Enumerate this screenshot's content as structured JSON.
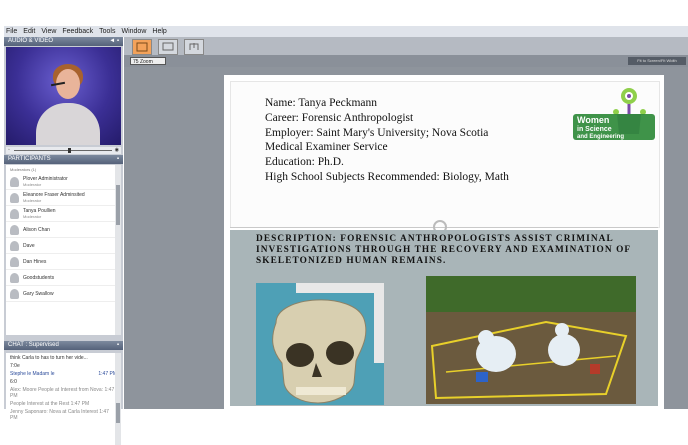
{
  "menu": [
    "File",
    "Edit",
    "View",
    "Feedback",
    "Tools",
    "Window",
    "Help"
  ],
  "panels": {
    "audio_video": {
      "title": "AUDIO & VIDEO"
    },
    "participants": {
      "title": "PARTICIPANTS",
      "summary": "Moderators (1)",
      "list": [
        {
          "name": "Plover Administrator",
          "role": "Moderator"
        },
        {
          "name": "Eleanore Fraser Adminsited",
          "role": "Moderator"
        },
        {
          "name": "Tanya Poullien",
          "role": "Moderator"
        },
        {
          "name": "Alison Chan",
          "role": ""
        },
        {
          "name": "Dave",
          "role": ""
        },
        {
          "name": "Dan Hines",
          "role": ""
        },
        {
          "name": "Goodstudents",
          "role": ""
        },
        {
          "name": "Gary Swallow",
          "role": ""
        }
      ]
    },
    "chat": {
      "title": "CHAT : Supervised",
      "messages": [
        "think Carla to has to turn her vide...",
        "7:0e",
        "Stephe le Madam le",
        "1:47 PM",
        "6:0",
        "Alex: Moore People at Interest from Nova: 1:47 PM",
        "People Interest at the Rest 1:47 PM",
        "Jenny Saponaro: Nova at Carla Interest 1:47 PM"
      ]
    }
  },
  "toolbar": {
    "zoom": "75 Zoom",
    "fit_label": "Fit to Screen/Fit Width"
  },
  "slide": {
    "info_lines": [
      "Name: Tanya Peckmann",
      "Career: Forensic Anthropologist",
      "Employer: Saint Mary's University; Nova Scotia",
      "Medical Examiner Service",
      "Education: Ph.D.",
      "High School Subjects Recommended: Biology, Math"
    ],
    "logo": [
      "Women",
      "in Science",
      "and Engineering"
    ],
    "description": "DESCRIPTION: FORENSIC ANTHROPOLOGISTS ASSIST CRIMINAL INVESTIGATIONS THROUGH THE RECOVERY AND EXAMINATION OF SKELETONIZED HUMAN REMAINS."
  }
}
